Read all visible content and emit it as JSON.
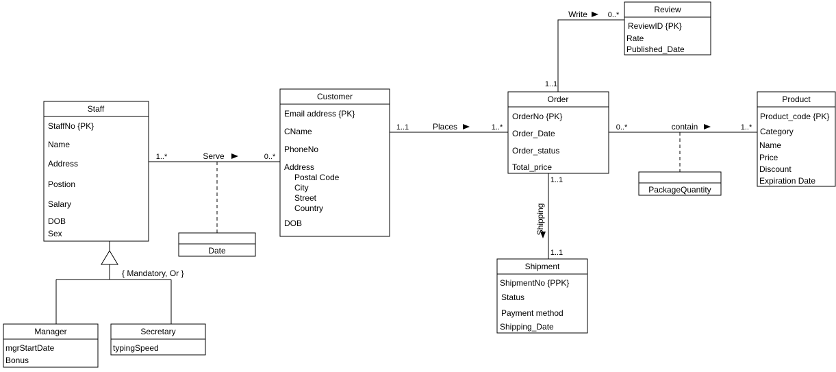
{
  "classes": {
    "staff": {
      "title": "Staff",
      "attrs": [
        "StaffNo {PK}",
        "Name",
        "Address",
        "Postion",
        "Salary",
        "DOB",
        "Sex"
      ]
    },
    "manager": {
      "title": "Manager",
      "attrs": [
        "mgrStartDate",
        "Bonus"
      ]
    },
    "secretary": {
      "title": "Secretary",
      "attrs": [
        "typingSpeed"
      ]
    },
    "date": {
      "title": "Date"
    },
    "customer": {
      "title": "Customer",
      "attrs": [
        "Email address {PK}",
        "CName",
        "PhoneNo",
        "Address",
        "Postal Code",
        "City",
        "Street",
        "Country",
        "DOB"
      ]
    },
    "order": {
      "title": "Order",
      "attrs": [
        "OrderNo {PK}",
        "Order_Date",
        "Order_status",
        "Total_price"
      ]
    },
    "review": {
      "title": "Review",
      "attrs": [
        "ReviewID {PK}",
        "Rate",
        "Published_Date"
      ]
    },
    "shipment": {
      "title": "Shipment",
      "attrs": [
        "ShipmentNo {PPK}",
        "Status",
        "Payment method",
        "Shipping_Date"
      ]
    },
    "pkgqty": {
      "title": "PackageQuantity"
    },
    "product": {
      "title": "Product",
      "attrs": [
        "Product_code {PK}",
        "Category",
        "Name",
        "Price",
        "Discount",
        "Expiration Date"
      ]
    }
  },
  "relations": {
    "serve": {
      "label": "Serve",
      "leftMult": "1..*",
      "rightMult": "0..*"
    },
    "places": {
      "label": "Places",
      "leftMult": "1..1",
      "rightMult": "1..*"
    },
    "write": {
      "label": "Write",
      "leftMult": "1..1",
      "rightMult": "0..*"
    },
    "shipping": {
      "label": "Shipping",
      "leftMult": "1..1",
      "rightMult": "1..1"
    },
    "contain": {
      "label": "contain",
      "leftMult": "0..*",
      "rightMult": "1..*"
    }
  },
  "constraint": "{ Mandatory, Or }"
}
